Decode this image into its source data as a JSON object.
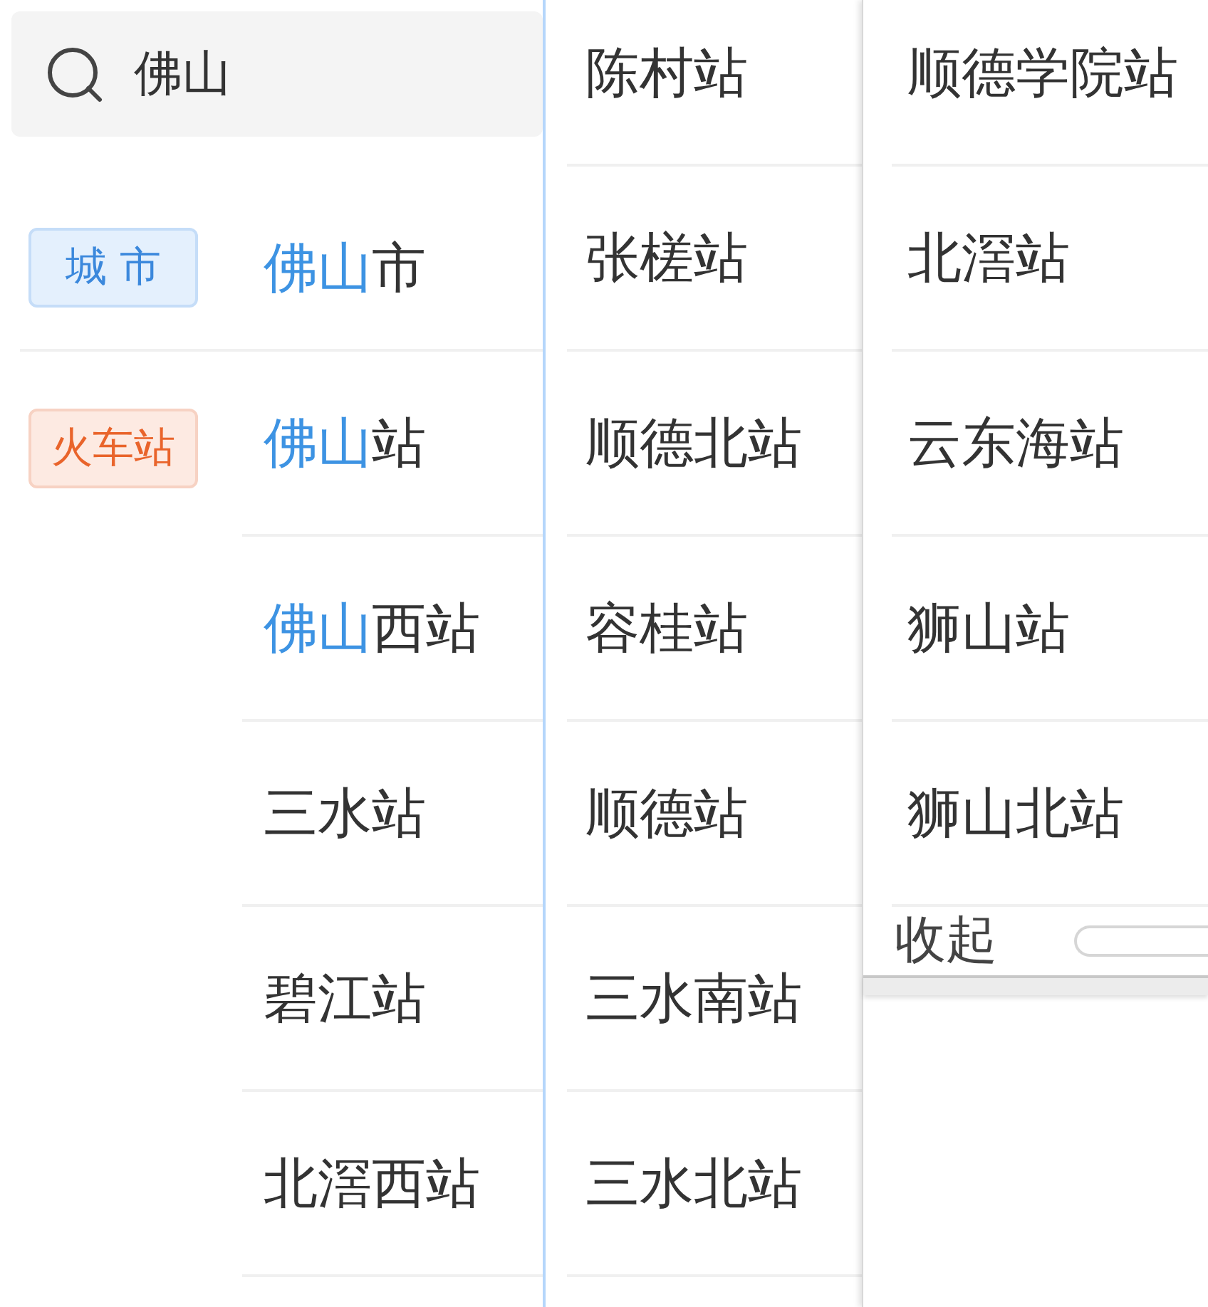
{
  "search": {
    "value": "佛山"
  },
  "groups": [
    {
      "category": {
        "kind": "city",
        "label": "城 市"
      },
      "results": [
        {
          "matched": "佛山",
          "text": "市"
        }
      ]
    },
    {
      "category": {
        "kind": "station",
        "label": "火车站"
      },
      "results": [
        {
          "matched": "佛山",
          "text": "站"
        },
        {
          "matched": "佛山",
          "text": "西站"
        },
        {
          "text": "三水站"
        },
        {
          "text": "碧江站"
        },
        {
          "text": "北滘西站"
        }
      ]
    }
  ],
  "station_columns": [
    {
      "items": [
        "陈村站",
        "张槎站",
        "顺德北站",
        "容桂站",
        "顺德站",
        "三水南站",
        "三水北站"
      ]
    },
    {
      "items": [
        "顺德学院站",
        "北滘站",
        "云东海站",
        "狮山站",
        "狮山北站"
      ],
      "collapse_button": "收起"
    }
  ]
}
